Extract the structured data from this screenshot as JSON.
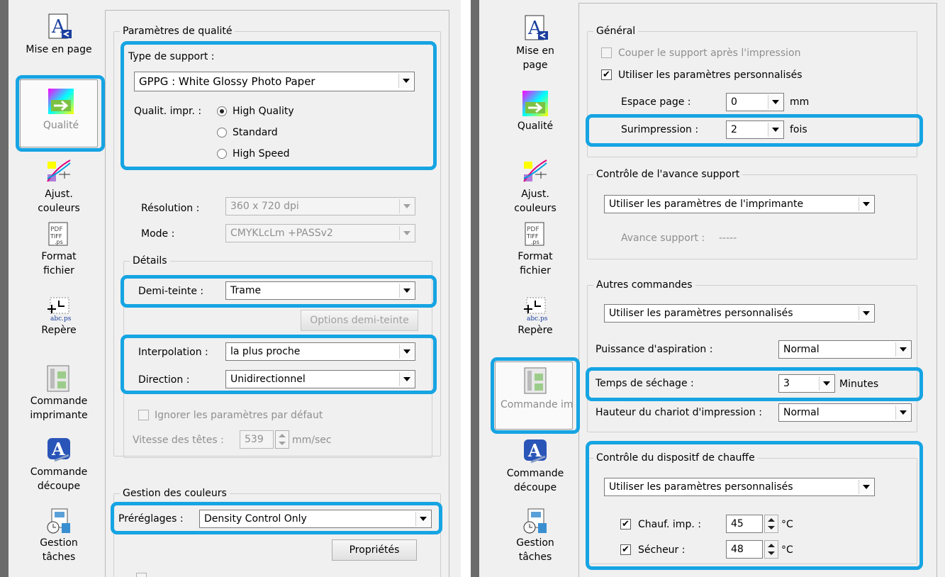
{
  "colors": {
    "highlight": "#16a4e3",
    "panel_bg": "#f0f0f0"
  },
  "left": {
    "nav": [
      {
        "label": "Mise en page",
        "icon": "page-layout-icon"
      },
      {
        "label": "Qualité",
        "icon": "quality-arrow-icon"
      },
      {
        "label": "Ajust. couleurs",
        "icon": "color-adjust-icon"
      },
      {
        "label": "Format fichier",
        "icon": "file-format-icon"
      },
      {
        "label": "Repère",
        "icon": "register-mark-icon"
      },
      {
        "label": "Commande imprimante",
        "icon": "printer-command-icon"
      },
      {
        "label": "Commande découpe",
        "icon": "cut-command-icon"
      },
      {
        "label": "Gestion tâches",
        "icon": "job-management-icon"
      }
    ],
    "quality_group": {
      "title": "Paramètres de qualité",
      "media_type_label": "Type de support :",
      "media_type_value": "GPPG : White Glossy Photo Paper",
      "print_quality_label": "Qualit. impr. :",
      "print_quality_options": [
        "High Quality",
        "Standard",
        "High Speed"
      ],
      "resolution_label": "Résolution :",
      "resolution_value": "360 x 720 dpi",
      "mode_label": "Mode :",
      "mode_value": "CMYKLcLm +PASSv2"
    },
    "details_group": {
      "title": "Détails",
      "halftone_label": "Demi-teinte :",
      "halftone_value": "Trame",
      "halftone_options_button": "Options demi-teinte",
      "interpolation_label": "Interpolation :",
      "interpolation_value": "la plus proche",
      "direction_label": "Direction :",
      "direction_value": "Unidirectionnel",
      "ignore_defaults_label": "Ignorer les paramètres par défaut",
      "head_speed_label": "Vitesse des têtes :",
      "head_speed_value": "539",
      "head_speed_unit": "mm/sec"
    },
    "color_group": {
      "title": "Gestion des couleurs",
      "presets_label": "Préréglages :",
      "presets_value": "Density Control Only",
      "properties_button": "Propriétés"
    }
  },
  "right": {
    "nav": [
      {
        "label": "Mise en page",
        "icon": "page-layout-icon"
      },
      {
        "label": "Qualité",
        "icon": "quality-arrow-icon"
      },
      {
        "label": "Ajust. couleurs",
        "icon": "color-adjust-icon"
      },
      {
        "label": "Format fichier",
        "icon": "file-format-icon"
      },
      {
        "label": "Repère",
        "icon": "register-mark-icon"
      },
      {
        "label": "Commande imprimante",
        "icon": "printer-command-icon"
      },
      {
        "label": "Commande découpe",
        "icon": "cut-command-icon"
      },
      {
        "label": "Gestion tâches",
        "icon": "job-management-icon"
      }
    ],
    "general_group": {
      "title": "Général",
      "cut_media_label": "Couper le support après l'impression",
      "use_custom_label": "Utiliser les paramètres personnalisés",
      "page_space_label": "Espace page :",
      "page_space_value": "0",
      "page_space_unit": "mm",
      "overprint_label": "Surimpression :",
      "overprint_value": "2",
      "overprint_unit": "fois"
    },
    "feed_group": {
      "title": "Contrôle de l'avance support",
      "feed_value": "Utiliser les paramètres de l'imprimante",
      "feed_amount_label": "Avance support :",
      "feed_amount_value": "-----"
    },
    "other_group": {
      "title": "Autres commandes",
      "other_value": "Utiliser les paramètres personnalisés",
      "suction_label": "Puissance d'aspiration :",
      "suction_value": "Normal",
      "drying_label": "Temps de séchage :",
      "drying_value": "3",
      "drying_unit": "Minutes",
      "carriage_label": "Hauteur du chariot d'impression :",
      "carriage_value": "Normal"
    },
    "heater_group": {
      "title": "Contrôle du dispositf de chauffe",
      "heater_value": "Utiliser les paramètres personnalisés",
      "print_heater_label": "Chauf. imp. :",
      "print_heater_value": "45",
      "dryer_label": "Sécheur :",
      "dryer_value": "48",
      "unit": "°C"
    }
  }
}
